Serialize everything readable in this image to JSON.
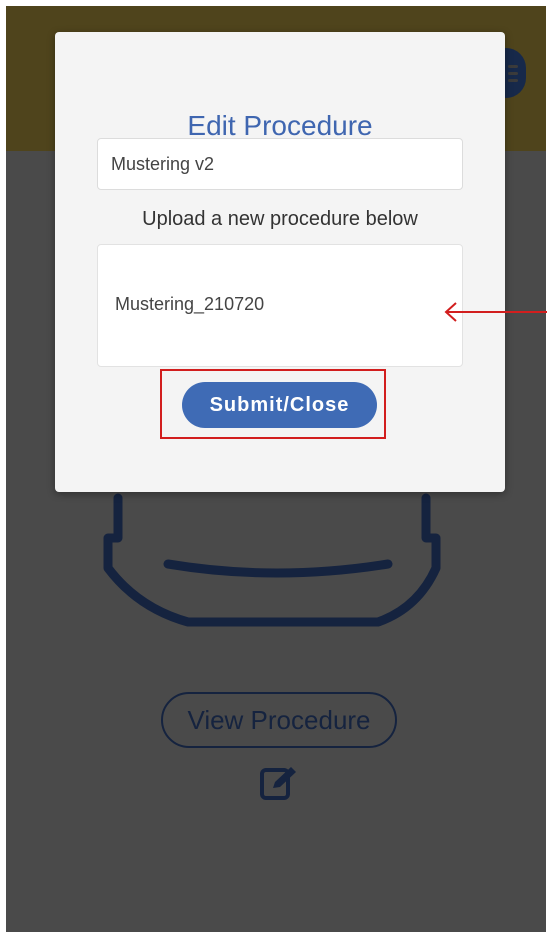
{
  "background": {
    "view_procedure_label": "View Procedure"
  },
  "modal": {
    "title": "Edit Procedure",
    "procedure_name_value": "Mustering v2",
    "upload_instruction": "Upload a new procedure below",
    "uploaded_file_name": "Mustering_210720",
    "submit_label": "Submit/Close"
  },
  "icons": {
    "menu": "hamburger-menu-icon",
    "helmet": "helmet-icon",
    "edit": "edit-pencil-icon"
  },
  "colors": {
    "header": "#4f441c",
    "overlay": "#4a4a4a",
    "accent": "#3f66b0",
    "highlight": "#d21e1e",
    "navy": "#15233f"
  }
}
